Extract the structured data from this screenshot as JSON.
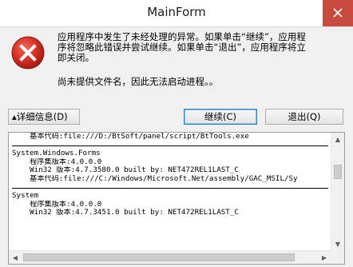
{
  "window": {
    "title": "MainForm"
  },
  "icons": {
    "close": "close-icon",
    "error": "error-icon",
    "scroll_up": "chevron-up-icon",
    "scroll_down": "chevron-down-icon",
    "scroll_left": "chevron-left-icon",
    "scroll_right": "chevron-right-icon"
  },
  "colors": {
    "close_button": "#c74a3f",
    "error_icon": "#c8281e",
    "dialog_background": "#f0f0f0"
  },
  "message": {
    "main": "应用程序中发生了未经处理的异常。如果单击“继续”，应用程\n序将忽略此错误并尝试继续。如果单击“退出”，应用程序将立\n即关闭。",
    "detail": "尚未提供文件名，因此无法启动进程。。"
  },
  "buttons": {
    "details": "▴详细信息(D)",
    "continue": "继续(C)",
    "quit": "退出(Q)"
  },
  "details": {
    "lines": [
      "    基本代码:file:///D:/BtSoft/panel/script/BtTools.exe",
      "----------------------------------------",
      "System.Windows.Forms",
      "    程序集版本:4.0.0.0",
      "    Win32 版本:4.7.3580.0 built by: NET472REL1LAST_C",
      "    基本代码:file:///C:/Windows/Microsoft.Net/assembly/GAC_MSIL/Sy",
      "----------------------------------------",
      "System",
      "    程序集版本:4.0.0.0",
      "    Win32 版本:4.7.3451.0 built by: NET472REL1LAST_C"
    ]
  }
}
